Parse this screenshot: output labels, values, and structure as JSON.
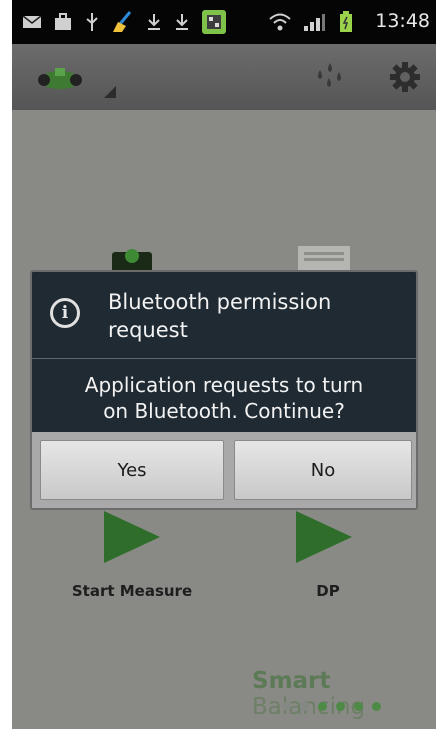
{
  "status_bar": {
    "time": "13:48",
    "icons": [
      "mail-icon",
      "bag-icon",
      "usb-icon",
      "broom-icon",
      "download-icon",
      "download-icon",
      "app-notification-icon",
      "wifi-icon",
      "signal-icon",
      "battery-icon"
    ]
  },
  "action_bar": {
    "app_icon": "robot-mower-icon",
    "icons": [
      "water-drops-icon",
      "gear-icon"
    ]
  },
  "main": {
    "items": [
      {
        "label": "Start Measure",
        "icon": "play-icon"
      },
      {
        "label": "DP",
        "icon": "play-icon"
      }
    ],
    "brand": {
      "bold": "Smart",
      "regular": "Balancing"
    },
    "page_dots": 6
  },
  "dialog": {
    "title": "Bluetooth permission request",
    "message_line1": "Application requests to turn",
    "message_line2": "on Bluetooth. Continue?",
    "yes_label": "Yes",
    "no_label": "No"
  },
  "colors": {
    "dialog_bg": "#1f2a33",
    "accent_green": "#2f6e2a",
    "app_bg": "#898a86"
  }
}
